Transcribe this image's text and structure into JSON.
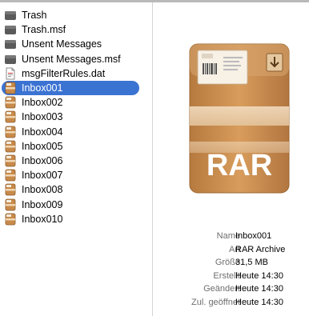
{
  "files": [
    {
      "name": "Trash",
      "icon": "folder-icon",
      "selected": false
    },
    {
      "name": "Trash.msf",
      "icon": "folder-icon",
      "selected": false
    },
    {
      "name": "Unsent Messages",
      "icon": "folder-icon",
      "selected": false
    },
    {
      "name": "Unsent Messages.msf",
      "icon": "folder-icon",
      "selected": false
    },
    {
      "name": "msgFilterRules.dat",
      "icon": "document-icon",
      "selected": false
    },
    {
      "name": "Inbox001",
      "icon": "rar-archive-icon",
      "selected": true
    },
    {
      "name": "Inbox002",
      "icon": "rar-archive-icon",
      "selected": false
    },
    {
      "name": "Inbox003",
      "icon": "rar-archive-icon",
      "selected": false
    },
    {
      "name": "Inbox004",
      "icon": "rar-archive-icon",
      "selected": false
    },
    {
      "name": "Inbox005",
      "icon": "rar-archive-icon",
      "selected": false
    },
    {
      "name": "Inbox006",
      "icon": "rar-archive-icon",
      "selected": false
    },
    {
      "name": "Inbox007",
      "icon": "rar-archive-icon",
      "selected": false
    },
    {
      "name": "Inbox008",
      "icon": "rar-archive-icon",
      "selected": false
    },
    {
      "name": "Inbox009",
      "icon": "rar-archive-icon",
      "selected": false
    },
    {
      "name": "Inbox010",
      "icon": "rar-archive-icon",
      "selected": false
    }
  ],
  "preview": {
    "icon_text": "RAR",
    "icon": "rar-archive-large-icon",
    "info": [
      {
        "key": "Name",
        "value": "Inbox001"
      },
      {
        "key": "Art",
        "value": "RAR Archive"
      },
      {
        "key": "Größe",
        "value": "31,5 MB"
      },
      {
        "key": "Erstellt",
        "value": "Heute 14:30"
      },
      {
        "key": "Geändert",
        "value": "Heute 14:30"
      },
      {
        "key": "Zul. geöffnet",
        "value": "Heute 14:30"
      }
    ]
  },
  "colors": {
    "selection": "#3b73d3",
    "folder": "#5a5a5a",
    "box": "#c88a4a"
  }
}
